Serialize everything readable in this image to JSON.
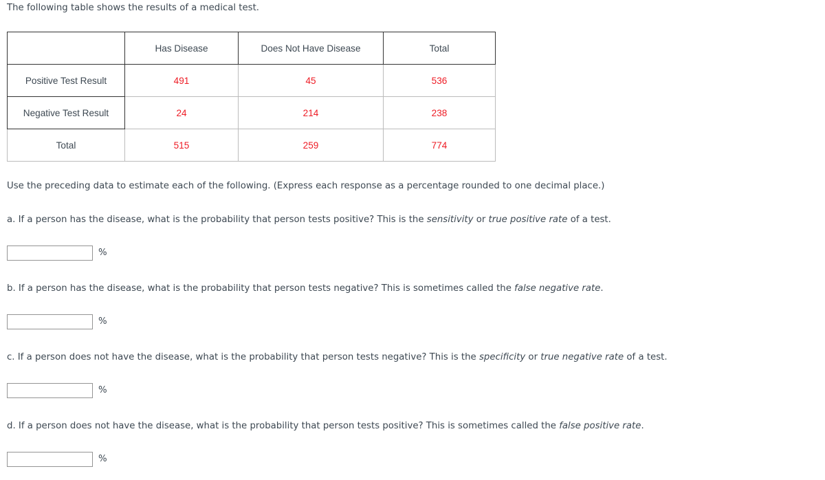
{
  "intro": "The following table shows the results of a medical test.",
  "table": {
    "columns": [
      "",
      "Has Disease",
      "Does Not Have Disease",
      "Total"
    ],
    "rows": [
      {
        "label": "Positive Test Result",
        "has_disease": "491",
        "no_disease": "45",
        "total": "536"
      },
      {
        "label": "Negative Test Result",
        "has_disease": "24",
        "no_disease": "214",
        "total": "238"
      },
      {
        "label": "Total",
        "has_disease": "515",
        "no_disease": "259",
        "total": "774"
      }
    ]
  },
  "instructions": {
    "lead": "Use the preceding data to estimate each of the following. (Express each response as a percentage rounded to one decimal place.)"
  },
  "questions": [
    {
      "id": "a",
      "prefix": "a. If a person has the disease, what is the probability that person tests positive? This is the ",
      "term1": "sensitivity",
      "middle": " or ",
      "term2": "true positive rate",
      "suffix": " of a test.",
      "value": "",
      "unit": "%"
    },
    {
      "id": "b",
      "prefix": "b. If a person has the disease, what is the probability that person tests negative? This is sometimes called the ",
      "term1": "false negative rate",
      "middle": "",
      "term2": "",
      "suffix": ".",
      "value": "",
      "unit": "%"
    },
    {
      "id": "c",
      "prefix": "c. If a person does not have the disease, what is the probability that person tests negative? This is the ",
      "term1": "specificity",
      "middle": " or ",
      "term2": "true negative rate",
      "suffix": " of a test.",
      "value": "",
      "unit": "%"
    },
    {
      "id": "d",
      "prefix": "d. If a person does not have the disease, what is the probability that person tests positive? This is sometimes called the ",
      "term1": "false positive rate",
      "middle": "",
      "term2": "",
      "suffix": ".",
      "value": "",
      "unit": "%"
    }
  ],
  "colors": {
    "number_red": "#ee1c25",
    "text_slate": "#3d4852",
    "border_dark": "#333333",
    "border_light": "#bbbbbb"
  }
}
